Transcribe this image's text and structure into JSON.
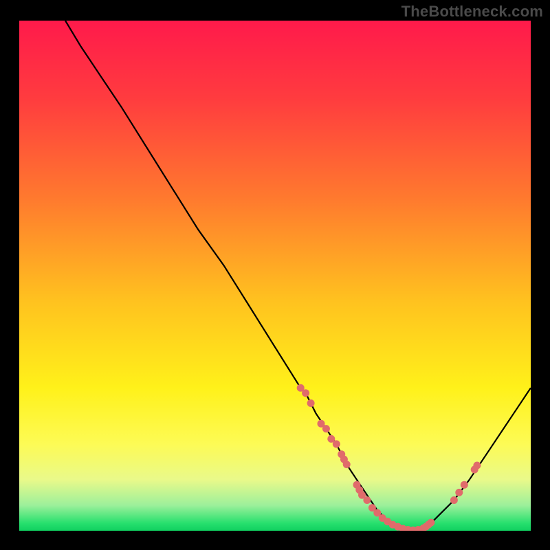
{
  "watermark": "TheBottleneck.com",
  "chart_data": {
    "type": "line",
    "title": "",
    "xlabel": "",
    "ylabel": "",
    "xlim": [
      0,
      100
    ],
    "ylim": [
      0,
      100
    ],
    "series": [
      {
        "name": "curve",
        "x": [
          9,
          12,
          16,
          20,
          25,
          30,
          35,
          40,
          45,
          50,
          55,
          56,
          58,
          60,
          62,
          64,
          66,
          68,
          70,
          72,
          74,
          76,
          78,
          80,
          82,
          85,
          88,
          92,
          96,
          100
        ],
        "y": [
          100,
          95,
          89,
          83,
          75,
          67,
          59,
          52,
          44,
          36,
          28,
          27,
          23,
          20,
          17,
          13,
          10,
          7,
          4,
          2,
          1,
          0,
          0,
          1,
          3,
          6,
          10,
          16,
          22,
          28
        ]
      }
    ],
    "markers": {
      "name": "data-points",
      "color": "#e06b6b",
      "points": [
        {
          "x": 55,
          "y": 28
        },
        {
          "x": 56,
          "y": 27
        },
        {
          "x": 57,
          "y": 25
        },
        {
          "x": 59,
          "y": 21
        },
        {
          "x": 60,
          "y": 20
        },
        {
          "x": 61,
          "y": 18
        },
        {
          "x": 62,
          "y": 17
        },
        {
          "x": 63,
          "y": 15
        },
        {
          "x": 63.5,
          "y": 14
        },
        {
          "x": 64,
          "y": 13
        },
        {
          "x": 66,
          "y": 9
        },
        {
          "x": 66.5,
          "y": 8
        },
        {
          "x": 67,
          "y": 7
        },
        {
          "x": 68,
          "y": 6
        },
        {
          "x": 69,
          "y": 4.5
        },
        {
          "x": 70,
          "y": 3.5
        },
        {
          "x": 71,
          "y": 2.5
        },
        {
          "x": 72,
          "y": 1.8
        },
        {
          "x": 73,
          "y": 1.2
        },
        {
          "x": 74,
          "y": 0.8
        },
        {
          "x": 75,
          "y": 0.4
        },
        {
          "x": 76,
          "y": 0.2
        },
        {
          "x": 77,
          "y": 0.1
        },
        {
          "x": 78,
          "y": 0.2
        },
        {
          "x": 79,
          "y": 0.5
        },
        {
          "x": 79.5,
          "y": 0.8
        },
        {
          "x": 80,
          "y": 1.2
        },
        {
          "x": 80.5,
          "y": 1.6
        },
        {
          "x": 85,
          "y": 6
        },
        {
          "x": 86,
          "y": 7.5
        },
        {
          "x": 87,
          "y": 9
        },
        {
          "x": 89,
          "y": 12
        },
        {
          "x": 89.5,
          "y": 12.8
        }
      ]
    },
    "background": {
      "type": "vertical-gradient",
      "stops": [
        {
          "pos": 0.0,
          "color": "#ff1a4b"
        },
        {
          "pos": 0.15,
          "color": "#ff3b3f"
        },
        {
          "pos": 0.35,
          "color": "#ff7a2e"
        },
        {
          "pos": 0.55,
          "color": "#ffc21f"
        },
        {
          "pos": 0.72,
          "color": "#fff11a"
        },
        {
          "pos": 0.83,
          "color": "#fdfb55"
        },
        {
          "pos": 0.9,
          "color": "#e9f98a"
        },
        {
          "pos": 0.95,
          "color": "#9df09b"
        },
        {
          "pos": 0.985,
          "color": "#28e06e"
        },
        {
          "pos": 1.0,
          "color": "#10d060"
        }
      ]
    }
  }
}
